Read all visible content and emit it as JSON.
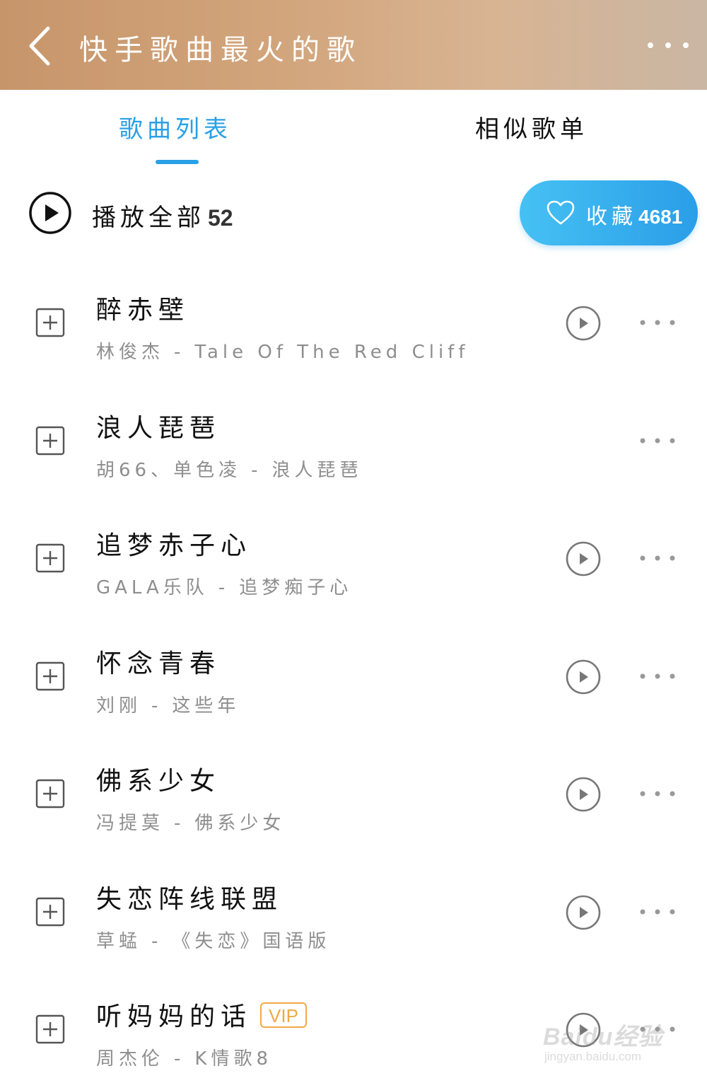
{
  "header": {
    "title": "快手歌曲最火的歌"
  },
  "tabs": [
    {
      "label": "歌曲列表",
      "active": true
    },
    {
      "label": "相似歌单",
      "active": false
    }
  ],
  "play_all": {
    "label": "播放全部",
    "count": "52"
  },
  "collect": {
    "label": "收藏",
    "count": "4681"
  },
  "songs": [
    {
      "title": "醉赤壁",
      "artist": "林俊杰",
      "album": "Tale Of The Red Cliff",
      "has_play": true,
      "vip": ""
    },
    {
      "title": "浪人琵琶",
      "artist": "胡66、单色凌",
      "album": "浪人琵琶",
      "has_play": false,
      "vip": ""
    },
    {
      "title": "追梦赤子心",
      "artist": "GALA乐队",
      "album": "追梦痴子心",
      "has_play": true,
      "vip": ""
    },
    {
      "title": "怀念青春",
      "artist": "刘刚",
      "album": "这些年",
      "has_play": true,
      "vip": ""
    },
    {
      "title": "佛系少女",
      "artist": "冯提莫",
      "album": "佛系少女",
      "has_play": true,
      "vip": ""
    },
    {
      "title": "失恋阵线联盟",
      "artist": "草蜢",
      "album": "《失恋》国语版",
      "has_play": true,
      "vip": ""
    },
    {
      "title": "听妈妈的话",
      "artist": "周杰伦",
      "album": "K情歌8",
      "has_play": true,
      "vip": "VIP"
    }
  ],
  "separator": "-",
  "watermark": {
    "main": "Baidu经验",
    "sub": "jingyan.baidu.com"
  },
  "icons": {
    "back": "chevron-left-icon",
    "more": "more-dots-icon",
    "play_all": "play-circle-icon",
    "heart": "heart-outline-icon",
    "add": "add-square-icon",
    "song_play": "play-circle-icon",
    "song_more": "more-dots-icon"
  },
  "colors": {
    "accent": "#2aa0e6",
    "header_gradient_start": "#c7956a",
    "header_gradient_end": "#c9b6a3",
    "vip": "#f0a946",
    "subtext": "#8e8e8e"
  }
}
